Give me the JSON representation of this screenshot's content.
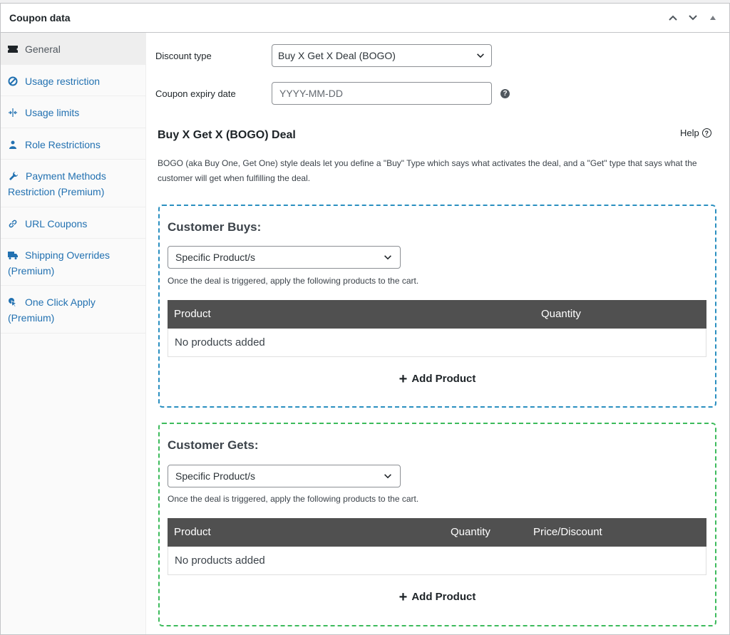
{
  "panel": {
    "title": "Coupon data"
  },
  "sidebar": {
    "items": [
      {
        "label": "General",
        "icon": "ticket-icon"
      },
      {
        "label": "Usage restriction",
        "icon": "block-icon"
      },
      {
        "label": "Usage limits",
        "icon": "limits-icon"
      },
      {
        "label": "Role Restrictions",
        "icon": "user-icon"
      },
      {
        "label": "Payment Methods Restriction (Premium)",
        "icon": "wrench-icon"
      },
      {
        "label": "URL Coupons",
        "icon": "link-icon"
      },
      {
        "label": "Shipping Overrides (Premium)",
        "icon": "truck-icon"
      },
      {
        "label": "One Click Apply (Premium)",
        "icon": "pointer-icon"
      }
    ]
  },
  "general": {
    "discount_type_label": "Discount type",
    "discount_type_value": "Buy X Get X Deal (BOGO)",
    "expiry_label": "Coupon expiry date",
    "expiry_placeholder": "YYYY-MM-DD"
  },
  "bogo": {
    "title": "Buy X Get X (BOGO) Deal",
    "help_label": "Help",
    "description": "BOGO (aka Buy One, Get One) style deals let you define a \"Buy\" Type which says what activates the deal, and a \"Get\" type that says what the customer will get when fulfilling the deal."
  },
  "buys": {
    "title": "Customer Buys:",
    "select_value": "Specific Product/s",
    "note": "Once the deal is triggered, apply the following products to the cart.",
    "columns": [
      "Product",
      "Quantity"
    ],
    "empty": "No products added",
    "add_label": "Add Product"
  },
  "gets": {
    "title": "Customer Gets:",
    "select_value": "Specific Product/s",
    "note": "Once the deal is triggered, apply the following products to the cart.",
    "columns": [
      "Product",
      "Quantity",
      "Price/Discount"
    ],
    "empty": "No products added",
    "add_label": "Add Product"
  },
  "colors": {
    "link": "#2271b1",
    "buys_border": "#2a8fc0",
    "gets_border": "#3dbb5c",
    "table_head": "#505050"
  }
}
